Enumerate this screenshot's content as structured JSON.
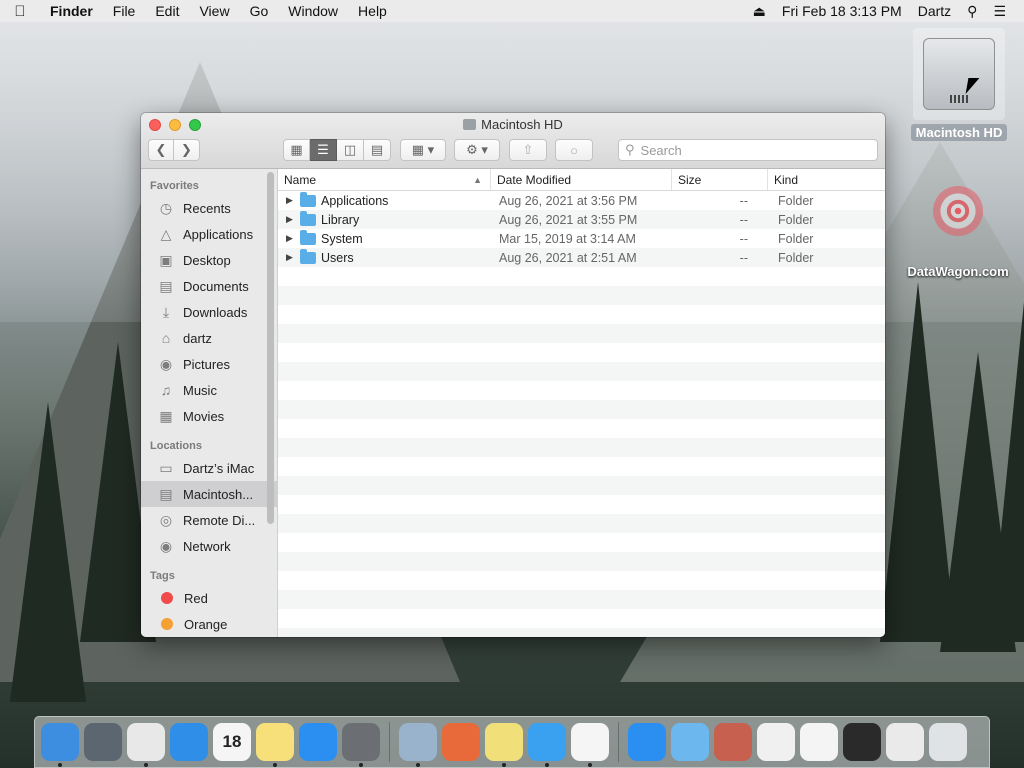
{
  "menubar": {
    "app_name": "Finder",
    "items": [
      "File",
      "Edit",
      "View",
      "Go",
      "Window",
      "Help"
    ],
    "datetime": "Fri Feb 18  3:13 PM",
    "user": "Dartz"
  },
  "desktop": {
    "icons": [
      {
        "label": "Macintosh HD"
      },
      {
        "label": "DataWagon.com"
      }
    ]
  },
  "window": {
    "title": "Macintosh HD",
    "search": {
      "placeholder": "Search"
    },
    "sidebar": {
      "favorites_header": "Favorites",
      "favorites": [
        {
          "label": "Recents",
          "icon": "clock-icon"
        },
        {
          "label": "Applications",
          "icon": "applications-icon"
        },
        {
          "label": "Desktop",
          "icon": "desktop-icon"
        },
        {
          "label": "Documents",
          "icon": "documents-icon"
        },
        {
          "label": "Downloads",
          "icon": "downloads-icon"
        },
        {
          "label": "dartz",
          "icon": "home-icon"
        },
        {
          "label": "Pictures",
          "icon": "camera-icon"
        },
        {
          "label": "Music",
          "icon": "music-icon"
        },
        {
          "label": "Movies",
          "icon": "film-icon"
        }
      ],
      "locations_header": "Locations",
      "locations": [
        {
          "label": "Dartz’s iMac",
          "icon": "imac-icon"
        },
        {
          "label": "Macintosh...",
          "icon": "hard-drive-icon",
          "selected": true
        },
        {
          "label": "Remote Di...",
          "icon": "disc-icon"
        },
        {
          "label": "Network",
          "icon": "globe-icon"
        }
      ],
      "tags_header": "Tags",
      "tags": [
        {
          "label": "Red",
          "color": "#f04a4a"
        },
        {
          "label": "Orange",
          "color": "#f5a032"
        }
      ]
    },
    "columns": {
      "name": "Name",
      "date": "Date Modified",
      "size": "Size",
      "kind": "Kind"
    },
    "files": [
      {
        "name": "Applications",
        "date": "Aug 26, 2021 at 3:56 PM",
        "size": "--",
        "kind": "Folder"
      },
      {
        "name": "Library",
        "date": "Aug 26, 2021 at 3:55 PM",
        "size": "--",
        "kind": "Folder"
      },
      {
        "name": "System",
        "date": "Mar 15, 2019 at 3:14 AM",
        "size": "--",
        "kind": "Folder"
      },
      {
        "name": "Users",
        "date": "Aug 26, 2021 at 2:51 AM",
        "size": "--",
        "kind": "Folder"
      }
    ]
  },
  "dock": {
    "apps": [
      {
        "name": "finder-icon",
        "color": "#3d8de0",
        "running": true
      },
      {
        "name": "launchpad-icon",
        "color": "#5c6670",
        "running": false
      },
      {
        "name": "chrome-icon",
        "color": "#e8e8e8",
        "running": true
      },
      {
        "name": "safari-icon",
        "color": "#2f8ee8",
        "running": false
      },
      {
        "name": "calendar-icon",
        "color": "#f5f5f5",
        "running": false,
        "text": "18"
      },
      {
        "name": "notes-icon",
        "color": "#f7e07a",
        "running": true
      },
      {
        "name": "app-store-icon",
        "color": "#2a8ff0",
        "running": false
      },
      {
        "name": "system-preferences-icon",
        "color": "#6b6f74",
        "running": true
      },
      {
        "name": "preview-icon",
        "color": "#9ab3cc",
        "running": true
      },
      {
        "name": "grapher-icon",
        "color": "#e86a3a",
        "running": false
      },
      {
        "name": "stickies-icon",
        "color": "#f1e07a",
        "running": true
      },
      {
        "name": "messages-icon",
        "color": "#3aa0f0",
        "running": true
      },
      {
        "name": "itunes-icon",
        "color": "#f5f5f5",
        "running": true
      },
      {
        "name": "app-store-folder-icon",
        "color": "#2a8ff0",
        "running": false
      },
      {
        "name": "folder-icon",
        "color": "#6cb8ee",
        "running": false
      },
      {
        "name": "photo-thumbnail-icon",
        "color": "#c86050",
        "running": false
      },
      {
        "name": "document-thumbnail-icon",
        "color": "#f0f0f0",
        "running": false
      },
      {
        "name": "document-thumbnail-icon",
        "color": "#f4f4f4",
        "running": false
      },
      {
        "name": "screenshot-thumbnail-icon",
        "color": "#2a2a2a",
        "running": false
      },
      {
        "name": "document-thumbnail-icon",
        "color": "#eaeaea",
        "running": false
      },
      {
        "name": "trash-icon",
        "color": "#dfe3e6",
        "running": false
      }
    ]
  }
}
